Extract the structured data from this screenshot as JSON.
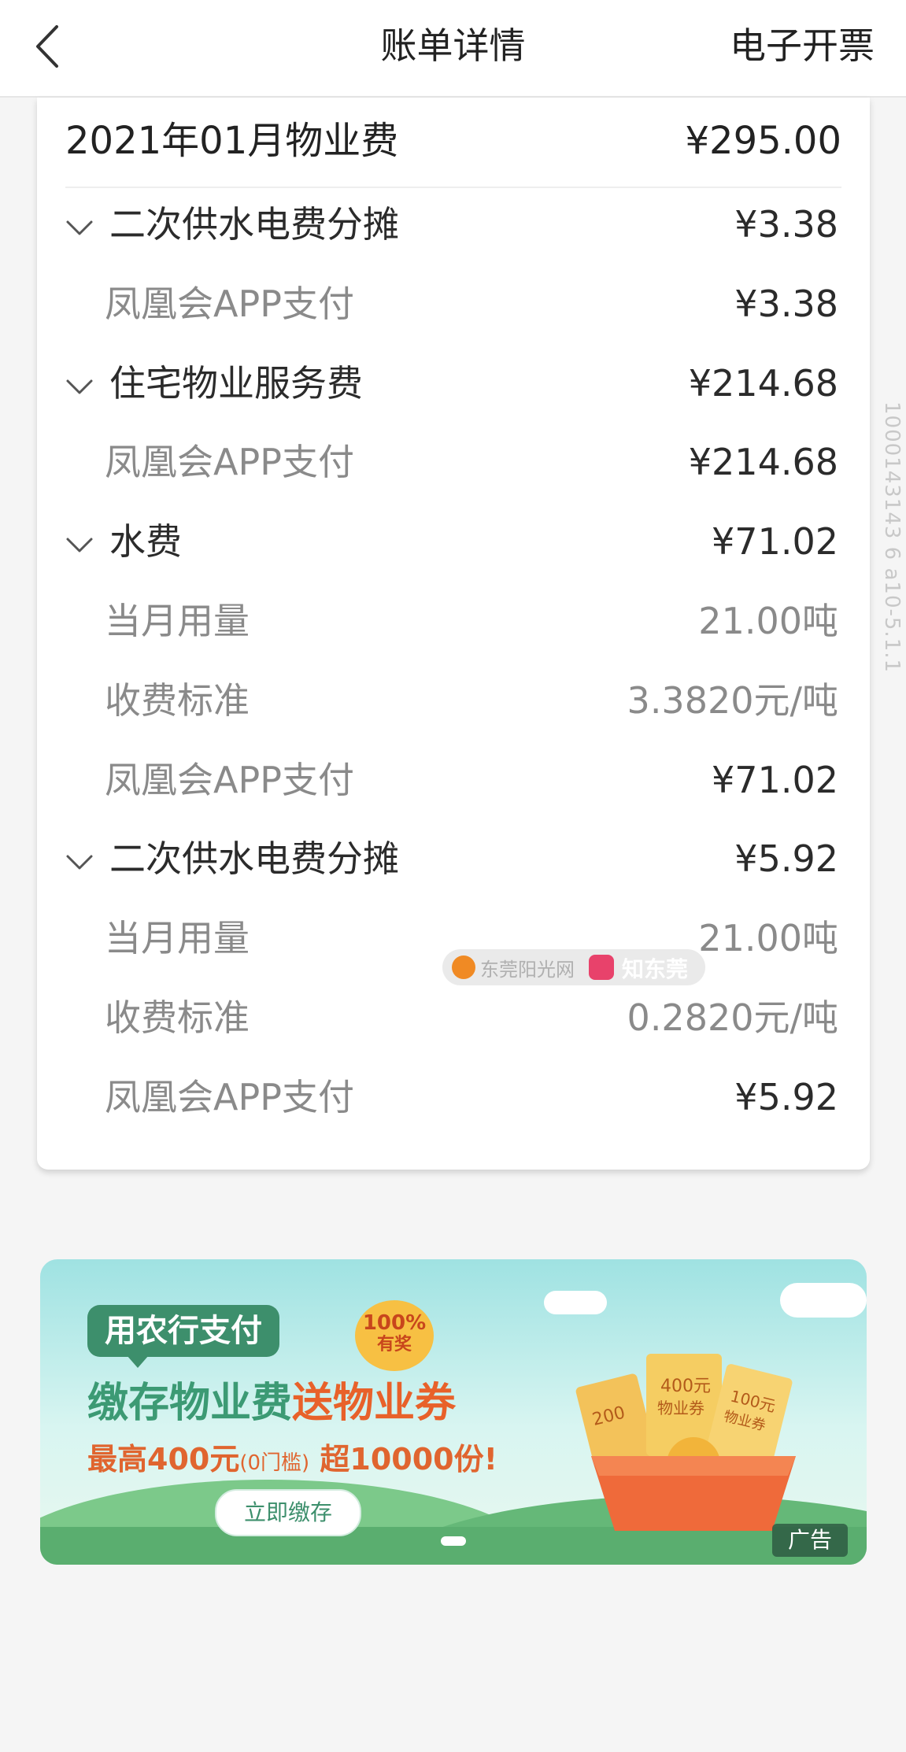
{
  "header": {
    "title": "账单详情",
    "invoice_label": "电子开票"
  },
  "summary": {
    "name": "2021年01月物业费",
    "amount": "¥295.00"
  },
  "rows": [
    {
      "kind": "item",
      "label": "二次供水电费分摊",
      "value": "¥3.38"
    },
    {
      "kind": "sub",
      "label": "凤凰会APP支付",
      "value": "¥3.38"
    },
    {
      "kind": "item",
      "label": "住宅物业服务费",
      "value": "¥214.68"
    },
    {
      "kind": "sub",
      "label": "凤凰会APP支付",
      "value": "¥214.68"
    },
    {
      "kind": "item",
      "label": "水费",
      "value": "¥71.02"
    },
    {
      "kind": "sub",
      "label": "当月用量",
      "value": "21.00吨"
    },
    {
      "kind": "sub",
      "label": "收费标准",
      "value": "3.3820元/吨"
    },
    {
      "kind": "sub",
      "label": "凤凰会APP支付",
      "value": "¥71.02"
    },
    {
      "kind": "item",
      "label": "二次供水电费分摊",
      "value": "¥5.92"
    },
    {
      "kind": "sub",
      "label": "当月用量",
      "value": "21.00吨"
    },
    {
      "kind": "sub",
      "label": "收费标准",
      "value": "0.2820元/吨"
    },
    {
      "kind": "sub",
      "label": "凤凰会APP支付",
      "value": "¥5.92"
    }
  ],
  "side_text": "1000143143 6 a10-5.1.1",
  "watermark": {
    "site": "东莞阳光网",
    "brand": "知东莞"
  },
  "banner": {
    "tag": "用农行支付",
    "badge_top": "100%",
    "badge_bottom": "有奖",
    "headline_a": "缴存物业费",
    "headline_b": "送物业券",
    "sub_a": "最高400元",
    "sub_small": "(0门槛)",
    "sub_b": " 超10000份!",
    "cta": "立即缴存",
    "ad_label": "广告",
    "coupon_1": "400元",
    "coupon_1b": "物业券",
    "coupon_2": "100元",
    "coupon_2b": "物业券",
    "coupon_3": "200"
  },
  "colors": {
    "accent_green": "#3d8f6c",
    "accent_orange": "#e8612a"
  }
}
